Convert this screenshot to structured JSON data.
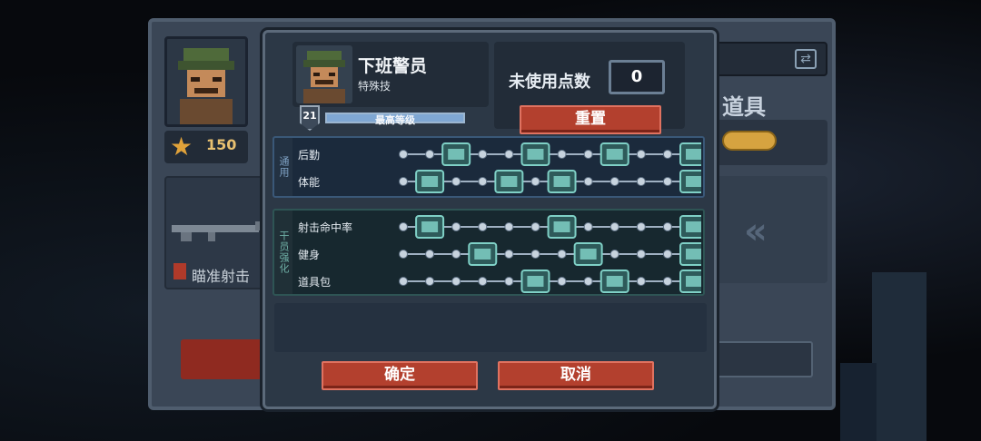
{
  "background": {
    "star_count": "150",
    "skill_label": "瞄准射击",
    "items_title": "道具"
  },
  "dialog": {
    "character": {
      "name": "下班警员",
      "class": "特殊技",
      "level": "21",
      "level_label": "最高等级",
      "level_progress": 1.0
    },
    "points": {
      "label": "未使用点数",
      "value": "0",
      "reset_label": "重置"
    },
    "groups": [
      {
        "tag": "通用",
        "rows": [
          {
            "label": "后勤",
            "unlocked_icons": [
              "supply-crate-icon",
              "shield-plus-icon",
              "medkit-icon",
              "ammo-stack-icon"
            ]
          },
          {
            "label": "体能",
            "unlocked_icons": [
              "melee-knife-icon",
              "sprint-boot-icon",
              "armor-vest-icon",
              "grenade-pouch-icon"
            ]
          }
        ]
      },
      {
        "tag": "干员强化",
        "rows": [
          {
            "label": "射击命中率",
            "unlocked_icons": [
              "bullet-spread-icon",
              "scope-rifle-icon",
              "crosshair-icon"
            ]
          },
          {
            "label": "健身",
            "unlocked_icons": [
              "fist-icon",
              "muscle-arm-icon",
              "running-figure-icon"
            ]
          },
          {
            "label": "道具包",
            "unlocked_icons": [
              "bag-icon",
              "gear-cluster-icon",
              "battery-pack-icon"
            ]
          }
        ]
      }
    ],
    "buttons": {
      "confirm": "确定",
      "cancel": "取消"
    }
  },
  "colors": {
    "accent_red": "#b3402e",
    "node_unlocked": "#7fd0c6",
    "track": "#9fb0c2"
  }
}
